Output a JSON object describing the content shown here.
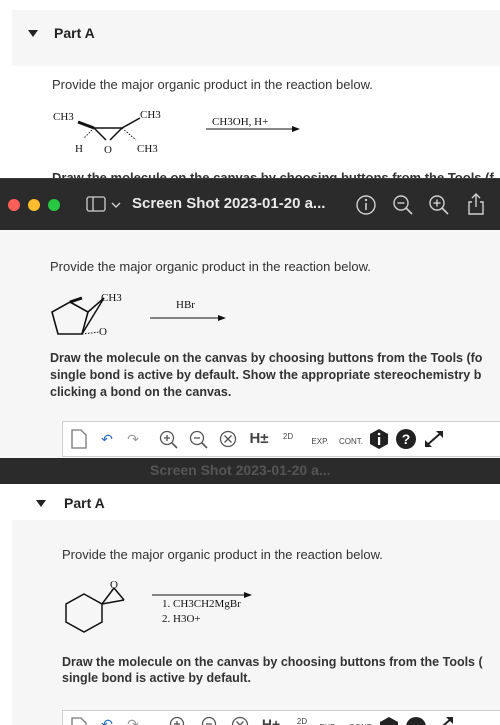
{
  "panel1": {
    "part_label": "Part A",
    "prompt": "Provide the major organic product in the reaction below.",
    "reactant": {
      "ch3_left": "CH3",
      "ch3_top": "CH3",
      "ch3_bottom": "CH3",
      "h": "H",
      "o": "O"
    },
    "reagent": "CH3OH, H+",
    "cut_text": "Draw the molecule on the canvas by choosing buttons from the Tools (f..."
  },
  "titlebar": {
    "title": "Screen Shot 2023-01-20 a...",
    "colors": {
      "close": "#ff5f57",
      "minimize": "#febc2e",
      "zoom": "#28c840"
    }
  },
  "panel2": {
    "prompt": "Provide the major organic product in the reaction below.",
    "reactant": {
      "ch3": "CH3",
      "o": "O"
    },
    "reagent": "HBr",
    "instruction_lines": [
      "Draw the molecule on the canvas by choosing buttons from the Tools (fo",
      "single bond is active by default. Show the appropriate stereochemistry b",
      "clicking a bond on the canvas."
    ],
    "toolbar": {
      "h_label": "H±",
      "twod_label": "2D",
      "exp_label": "EXP.",
      "cont_label": "CONT."
    }
  },
  "panel3": {
    "part_label": "Part A",
    "prompt": "Provide the major organic product in the reaction below.",
    "reactant": {
      "o": "O"
    },
    "reagent_lines": [
      "1. CH3CH2MgBr",
      "2. H3O+"
    ],
    "instruction_lines": [
      "Draw the molecule on the canvas by choosing buttons from the Tools (",
      "single bond is active by default."
    ],
    "toolbar": {
      "h_label": "H+",
      "twod_label": "2D",
      "exp_label": "EXP.",
      "cont_label": "CONT."
    }
  }
}
